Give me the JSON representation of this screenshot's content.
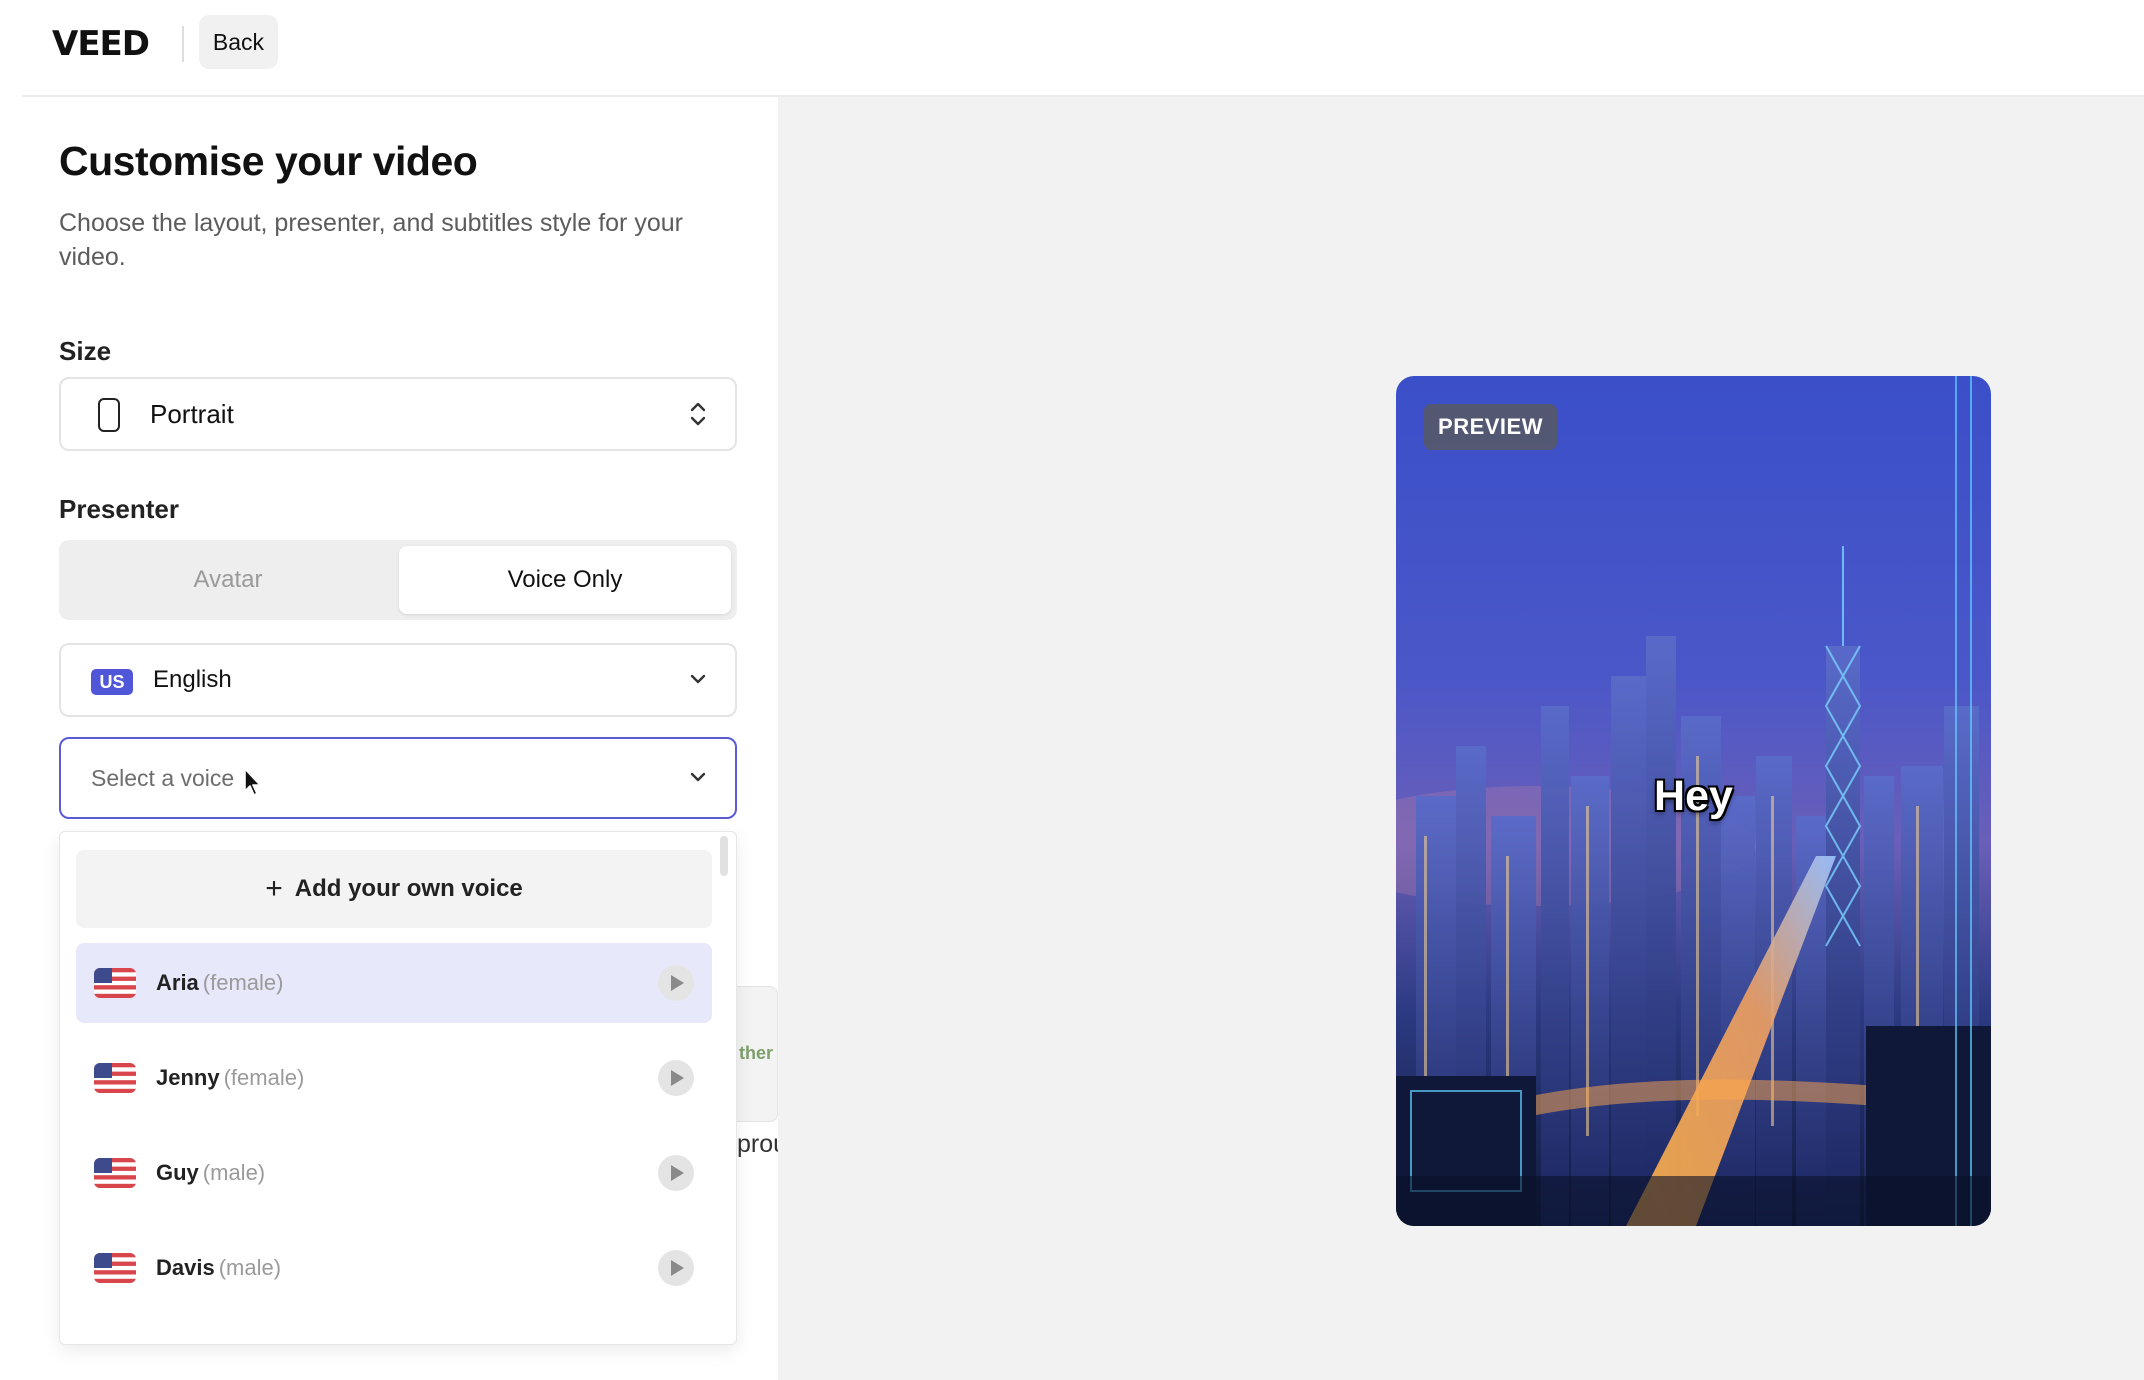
{
  "header": {
    "logo": "VEED",
    "back_label": "Back"
  },
  "panel": {
    "title": "Customise your video",
    "description": "Choose the layout, presenter, and subtitles style for your video."
  },
  "size": {
    "label": "Size",
    "value": "Portrait",
    "icon": "phone-portrait-icon"
  },
  "presenter": {
    "label": "Presenter",
    "options": [
      "Avatar",
      "Voice Only"
    ],
    "selected": "Voice Only"
  },
  "language": {
    "badge": "US",
    "value": "English"
  },
  "voice_select": {
    "placeholder": "Select a voice"
  },
  "dropdown": {
    "add_label": "Add your own voice",
    "voices": [
      {
        "name": "Aria",
        "gender": "(female)",
        "flag": "us-flag-icon"
      },
      {
        "name": "Jenny",
        "gender": "(female)",
        "flag": "us-flag-icon"
      },
      {
        "name": "Guy",
        "gender": "(male)",
        "flag": "us-flag-icon"
      },
      {
        "name": "Davis",
        "gender": "(male)",
        "flag": "us-flag-icon"
      }
    ]
  },
  "background_partial": {
    "card_text": "ther",
    "text": "prou"
  },
  "preview": {
    "badge": "PREVIEW",
    "caption": "Hey"
  },
  "colors": {
    "accent": "#5b5bd6",
    "highlight": "#e8e8fb",
    "badge_blue": "#4f56d8",
    "right_panel_bg": "#f2f2f2"
  }
}
